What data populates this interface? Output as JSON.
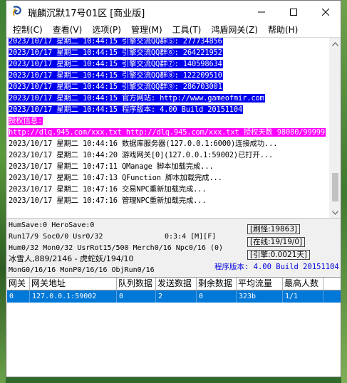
{
  "window": {
    "title": "瑞麟沉默17号01区 [商业版]",
    "icon": "cyclone-icon"
  },
  "menu": [
    {
      "label": "控制(C)"
    },
    {
      "label": "查看(V)"
    },
    {
      "label": "选项(P)"
    },
    {
      "label": "管理(M)"
    },
    {
      "label": "工具(T)"
    },
    {
      "label": "鸿盾网关(Z)"
    },
    {
      "label": "帮助(H)"
    }
  ],
  "log": {
    "lines": [
      {
        "text": "2023/10/17 星期二 10:44:15 引擎交流QQ群⑤: 277734856",
        "style": "blue"
      },
      {
        "text": "2023/10/17 星期二 10:44:15 引擎交流QQ群⑥: 264221952",
        "style": "blue"
      },
      {
        "text": "2023/10/17 星期二 10:44:15 引擎交流QQ群⑦: 140598634",
        "style": "blue"
      },
      {
        "text": "2023/10/17 星期二 10:44:15 引擎交流QQ群⑧: 122209510",
        "style": "blue"
      },
      {
        "text": "2023/10/17 星期二 10:44:15 引擎交流QQ群⑨: 286703001",
        "style": "blue"
      },
      {
        "text": "2023/10/17 星期二 10:44:15 官方网站: http://www.gameofmir.com",
        "style": "blue"
      },
      {
        "text": "2023/10/17 星期二 10:44:15 程序版本: 4.00 Build 20151104",
        "style": "blue"
      },
      {
        "text": "授权信息:",
        "style": "magenta"
      },
      {
        "text": "http://dlq.945.com/xxx.txt http://dlq.945.com/xxx.txt 授权天数 98080/99999",
        "style": "magenta"
      },
      {
        "text": "2023/10/17 星期二 10:44:16 数据库服务器(127.0.0.1:6000)连接成功...",
        "style": "plain"
      },
      {
        "text": "2023/10/17 星期二 10:44:20 游戏网关[0](127.0.0.1:59002)已打开...",
        "style": "plain"
      },
      {
        "text": "2023/10/17 星期二 10:47:11 QManage 脚本加载完成...",
        "style": "plain"
      },
      {
        "text": "2023/10/17 星期二 10:47:13 QFunction 脚本加载完成...",
        "style": "plain"
      },
      {
        "text": "2023/10/17 星期二 10:47:16 交易NPC重新加载完成...",
        "style": "plain"
      },
      {
        "text": "2023/10/17 星期二 10:47:16 管理NPC重新加载完成...",
        "style": "plain"
      }
    ]
  },
  "status": {
    "hum_save": "HumSave:0 HeroSave:0",
    "run": "Run17/9 Soc0/0 Usr0/32",
    "time": "0:3:4 [M][F]",
    "hum": "Hum0/32 Mon0/32 UsrRot15/500 Merch0/16 Npc0/16 (0)",
    "monster": "冰雪人,889/2146 - 虎蛇妖/194/10",
    "mon_gen": "MonG0/16/16 MonP0/16/16 ObjRun0/16",
    "refresh": "[刷怪:19863]",
    "online": "[在线:19/19/0]",
    "engine": "[引擎:0.0021天]",
    "version": "程序版本: 4.00 Build 20151104"
  },
  "table": {
    "headers": [
      "网关",
      "网关地址",
      "队列数据",
      "发送数据",
      "剩余数据",
      "平均流量",
      "最高人数"
    ],
    "rows": [
      [
        "0",
        "127.0.0.1:59002",
        "0",
        "2",
        "0",
        "323b",
        "1/1"
      ]
    ]
  },
  "colors": {
    "highlight_blue": "#0000ee",
    "highlight_magenta": "#ff00ff",
    "selected_row": "#0078d7",
    "version_text": "#0000dd"
  }
}
